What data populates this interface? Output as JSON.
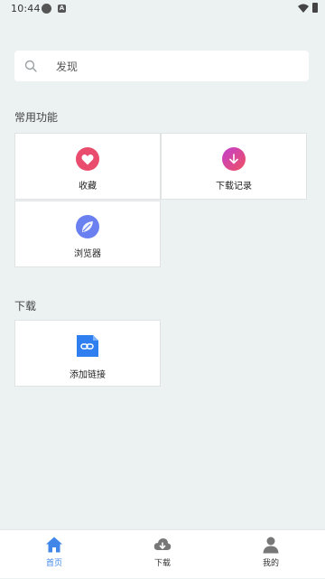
{
  "status_bar": {
    "time": "10:44",
    "a_badge": "A"
  },
  "search": {
    "placeholder": "发现"
  },
  "sections": {
    "common": {
      "title": "常用功能",
      "items": [
        {
          "label": "收藏",
          "icon": "heart-icon",
          "color": "#e94c6d"
        },
        {
          "label": "下载记录",
          "icon": "download-arrow-icon",
          "color": "#e8457a"
        },
        {
          "label": "浏览器",
          "icon": "leaf-icon",
          "color": "#6a7ff0"
        }
      ]
    },
    "download": {
      "title": "下载",
      "items": [
        {
          "label": "添加链接",
          "icon": "link-icon",
          "color": "#2f7ff0"
        }
      ]
    }
  },
  "bottom_nav": {
    "items": [
      {
        "label": "首页",
        "icon": "home-icon",
        "active": true
      },
      {
        "label": "下载",
        "icon": "cloud-download-icon",
        "active": false
      },
      {
        "label": "我的",
        "icon": "person-icon",
        "active": false
      }
    ],
    "active_color": "#3f86e8",
    "inactive_color": "#777777"
  }
}
